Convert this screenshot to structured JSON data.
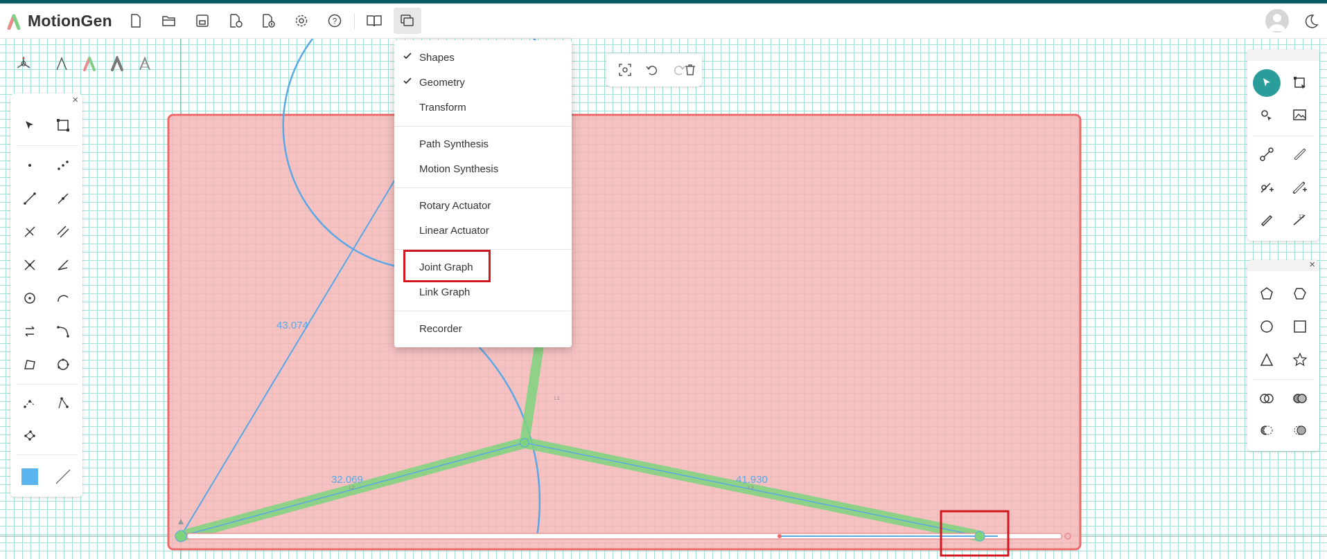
{
  "app": {
    "name": "MotionGen"
  },
  "toolbar": {
    "icons": [
      "new-file-icon",
      "open-folder-icon",
      "save-icon",
      "export-icon",
      "import-icon",
      "settings-icon",
      "help-icon",
      "book-icon",
      "windows-icon"
    ]
  },
  "menu": {
    "items": [
      {
        "label": "Shapes",
        "checked": true
      },
      {
        "label": "Geometry",
        "checked": true
      },
      {
        "label": "Transform",
        "checked": false
      },
      {
        "label": "Path Synthesis",
        "checked": false
      },
      {
        "label": "Motion Synthesis",
        "checked": false
      },
      {
        "label": "Rotary Actuator",
        "checked": false
      },
      {
        "label": "Linear Actuator",
        "checked": false
      },
      {
        "label": "Joint Graph",
        "checked": false
      },
      {
        "label": "Link Graph",
        "checked": false
      },
      {
        "label": "Recorder",
        "checked": false
      }
    ]
  },
  "canvas": {
    "dimensions": [
      "43.074",
      "32.069",
      "41.930"
    ],
    "small_labels": [
      "L1",
      "L2",
      "L3"
    ]
  },
  "colors": {
    "accent": "#2a9d9b",
    "topbar": "#0b5a63",
    "shape_fill": "#f6b6b6",
    "shape_border": "#ea6a6a",
    "link_green": "#7ed47e",
    "geometry_blue": "#5aa7e6",
    "highlight": "#d0181e"
  }
}
